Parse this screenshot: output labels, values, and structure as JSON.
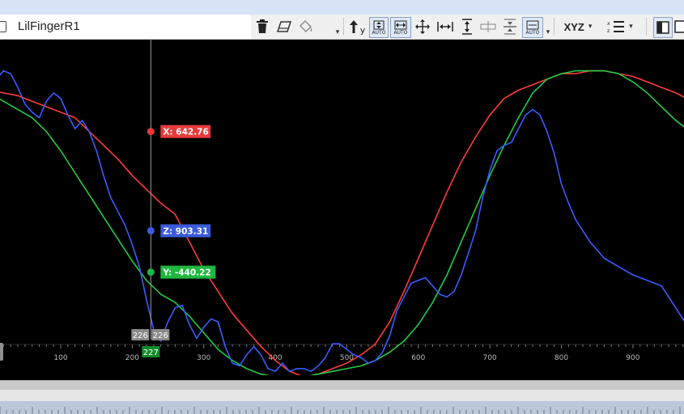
{
  "window": {
    "track_name": "LilFingerR1",
    "menu_caret": "▾"
  },
  "toolbar": {
    "delete_icon": "trash-icon",
    "eraser_icon": "eraser-icon",
    "fill_icon": "fill-bucket-icon",
    "axis_up_label": "y",
    "auto_label_1": "AUTO",
    "auto_label_2": "AUTO",
    "auto_label_3": "AUTO",
    "xyz_label": "XYZ",
    "caret": "▾"
  },
  "chart_data": {
    "type": "line",
    "xlim": [
      -130,
      975
    ],
    "ylim": [
      0,
      100
    ],
    "x_ticks": [
      100,
      200,
      300,
      400,
      500,
      600,
      700,
      800,
      900
    ],
    "x_tick_labels": [
      "100",
      "200",
      "300",
      "400",
      "500",
      "600",
      "700",
      "800",
      "900"
    ],
    "grid": false,
    "series": [
      {
        "name": "X",
        "color": "#ff3b3b",
        "points": [
          [
            -15,
            89
          ],
          [
            0,
            89
          ],
          [
            20,
            88
          ],
          [
            40,
            87
          ],
          [
            60,
            85
          ],
          [
            80,
            83
          ],
          [
            100,
            81
          ],
          [
            120,
            79
          ],
          [
            140,
            74
          ],
          [
            160,
            69
          ],
          [
            180,
            64
          ],
          [
            200,
            58
          ],
          [
            220,
            53
          ],
          [
            240,
            48
          ],
          [
            260,
            44
          ],
          [
            280,
            34
          ],
          [
            300,
            24
          ],
          [
            320,
            16
          ],
          [
            340,
            8
          ],
          [
            360,
            2
          ],
          [
            380,
            -4
          ],
          [
            400,
            -9
          ],
          [
            420,
            -13
          ],
          [
            440,
            -15
          ],
          [
            460,
            -14
          ],
          [
            480,
            -12
          ],
          [
            500,
            -10
          ],
          [
            520,
            -7
          ],
          [
            540,
            -3
          ],
          [
            560,
            5
          ],
          [
            580,
            16
          ],
          [
            600,
            28
          ],
          [
            620,
            40
          ],
          [
            640,
            52
          ],
          [
            660,
            63
          ],
          [
            680,
            72
          ],
          [
            700,
            80
          ],
          [
            720,
            86
          ],
          [
            740,
            89
          ],
          [
            760,
            91
          ],
          [
            780,
            93
          ],
          [
            800,
            95
          ],
          [
            820,
            95
          ],
          [
            840,
            96
          ],
          [
            860,
            96
          ],
          [
            880,
            95
          ],
          [
            900,
            94
          ],
          [
            920,
            92
          ],
          [
            940,
            90
          ],
          [
            960,
            88
          ],
          [
            975,
            86
          ]
        ]
      },
      {
        "name": "Y",
        "color": "#22cc44",
        "points": [
          [
            -15,
            86
          ],
          [
            0,
            88
          ],
          [
            20,
            85
          ],
          [
            40,
            82
          ],
          [
            60,
            79
          ],
          [
            80,
            74
          ],
          [
            100,
            67
          ],
          [
            120,
            59
          ],
          [
            140,
            51
          ],
          [
            160,
            43
          ],
          [
            180,
            35
          ],
          [
            200,
            27
          ],
          [
            220,
            20
          ],
          [
            240,
            15
          ],
          [
            260,
            12
          ],
          [
            280,
            7
          ],
          [
            300,
            1
          ],
          [
            320,
            -5
          ],
          [
            340,
            -9
          ],
          [
            360,
            -12
          ],
          [
            380,
            -14
          ],
          [
            400,
            -15
          ],
          [
            420,
            -15
          ],
          [
            440,
            -15
          ],
          [
            460,
            -14
          ],
          [
            480,
            -13
          ],
          [
            500,
            -12
          ],
          [
            520,
            -11
          ],
          [
            540,
            -9
          ],
          [
            560,
            -6
          ],
          [
            580,
            -2
          ],
          [
            600,
            4
          ],
          [
            620,
            12
          ],
          [
            640,
            22
          ],
          [
            660,
            34
          ],
          [
            680,
            46
          ],
          [
            700,
            58
          ],
          [
            720,
            69
          ],
          [
            740,
            79
          ],
          [
            760,
            88
          ],
          [
            780,
            93
          ],
          [
            800,
            95
          ],
          [
            820,
            96
          ],
          [
            840,
            96
          ],
          [
            860,
            96
          ],
          [
            880,
            95
          ],
          [
            900,
            92
          ],
          [
            920,
            88
          ],
          [
            940,
            83
          ],
          [
            960,
            78
          ],
          [
            975,
            75
          ]
        ]
      },
      {
        "name": "Z",
        "color": "#3a5cff",
        "points": [
          [
            -15,
            85
          ],
          [
            0,
            88
          ],
          [
            10,
            93
          ],
          [
            20,
            96
          ],
          [
            30,
            95
          ],
          [
            40,
            90
          ],
          [
            50,
            84
          ],
          [
            60,
            81
          ],
          [
            70,
            79
          ],
          [
            80,
            85
          ],
          [
            90,
            88
          ],
          [
            100,
            86
          ],
          [
            110,
            80
          ],
          [
            120,
            75
          ],
          [
            130,
            78
          ],
          [
            140,
            74
          ],
          [
            150,
            67
          ],
          [
            160,
            58
          ],
          [
            170,
            50
          ],
          [
            180,
            45
          ],
          [
            190,
            40
          ],
          [
            200,
            33
          ],
          [
            210,
            25
          ],
          [
            220,
            13
          ],
          [
            230,
            2
          ],
          [
            240,
            -2
          ],
          [
            250,
            5
          ],
          [
            260,
            10
          ],
          [
            270,
            11
          ],
          [
            280,
            4
          ],
          [
            290,
            -1
          ],
          [
            300,
            3
          ],
          [
            310,
            6
          ],
          [
            320,
            5
          ],
          [
            330,
            -4
          ],
          [
            340,
            -10
          ],
          [
            350,
            -11
          ],
          [
            360,
            -7
          ],
          [
            370,
            -4
          ],
          [
            380,
            -7
          ],
          [
            390,
            -12
          ],
          [
            400,
            -13
          ],
          [
            410,
            -10
          ],
          [
            420,
            -13
          ],
          [
            430,
            -12
          ],
          [
            440,
            -12
          ],
          [
            450,
            -13
          ],
          [
            460,
            -11
          ],
          [
            470,
            -8
          ],
          [
            480,
            -3
          ],
          [
            490,
            -3
          ],
          [
            500,
            -5
          ],
          [
            510,
            -7
          ],
          [
            520,
            -8
          ],
          [
            530,
            -10
          ],
          [
            540,
            -9
          ],
          [
            550,
            -6
          ],
          [
            560,
            0
          ],
          [
            570,
            9
          ],
          [
            580,
            14
          ],
          [
            590,
            19
          ],
          [
            600,
            20
          ],
          [
            610,
            21
          ],
          [
            620,
            18
          ],
          [
            630,
            15
          ],
          [
            640,
            14
          ],
          [
            650,
            16
          ],
          [
            660,
            22
          ],
          [
            670,
            30
          ],
          [
            680,
            38
          ],
          [
            690,
            50
          ],
          [
            700,
            60
          ],
          [
            710,
            67
          ],
          [
            720,
            69
          ],
          [
            730,
            70
          ],
          [
            740,
            75
          ],
          [
            750,
            80
          ],
          [
            760,
            82
          ],
          [
            770,
            80
          ],
          [
            780,
            74
          ],
          [
            790,
            66
          ],
          [
            800,
            55
          ],
          [
            810,
            48
          ],
          [
            820,
            42
          ],
          [
            830,
            38
          ],
          [
            840,
            34
          ],
          [
            860,
            28
          ],
          [
            880,
            25
          ],
          [
            900,
            22
          ],
          [
            920,
            20
          ],
          [
            940,
            18
          ],
          [
            960,
            10
          ],
          [
            975,
            4
          ]
        ]
      }
    ],
    "cursor": {
      "x": 226,
      "top_label_left": "226",
      "top_label_right": "226",
      "bottom_label": "227",
      "markers": [
        {
          "series": "X",
          "label": "X: 642.76",
          "y": 74,
          "color": "#e83a3a"
        },
        {
          "series": "Z",
          "label": "Z: 903.31",
          "y": 38,
          "color": "#3a5cdc"
        },
        {
          "series": "Y",
          "label": "Y: -440.22",
          "y": 23,
          "color": "#1fb83f"
        }
      ]
    }
  }
}
